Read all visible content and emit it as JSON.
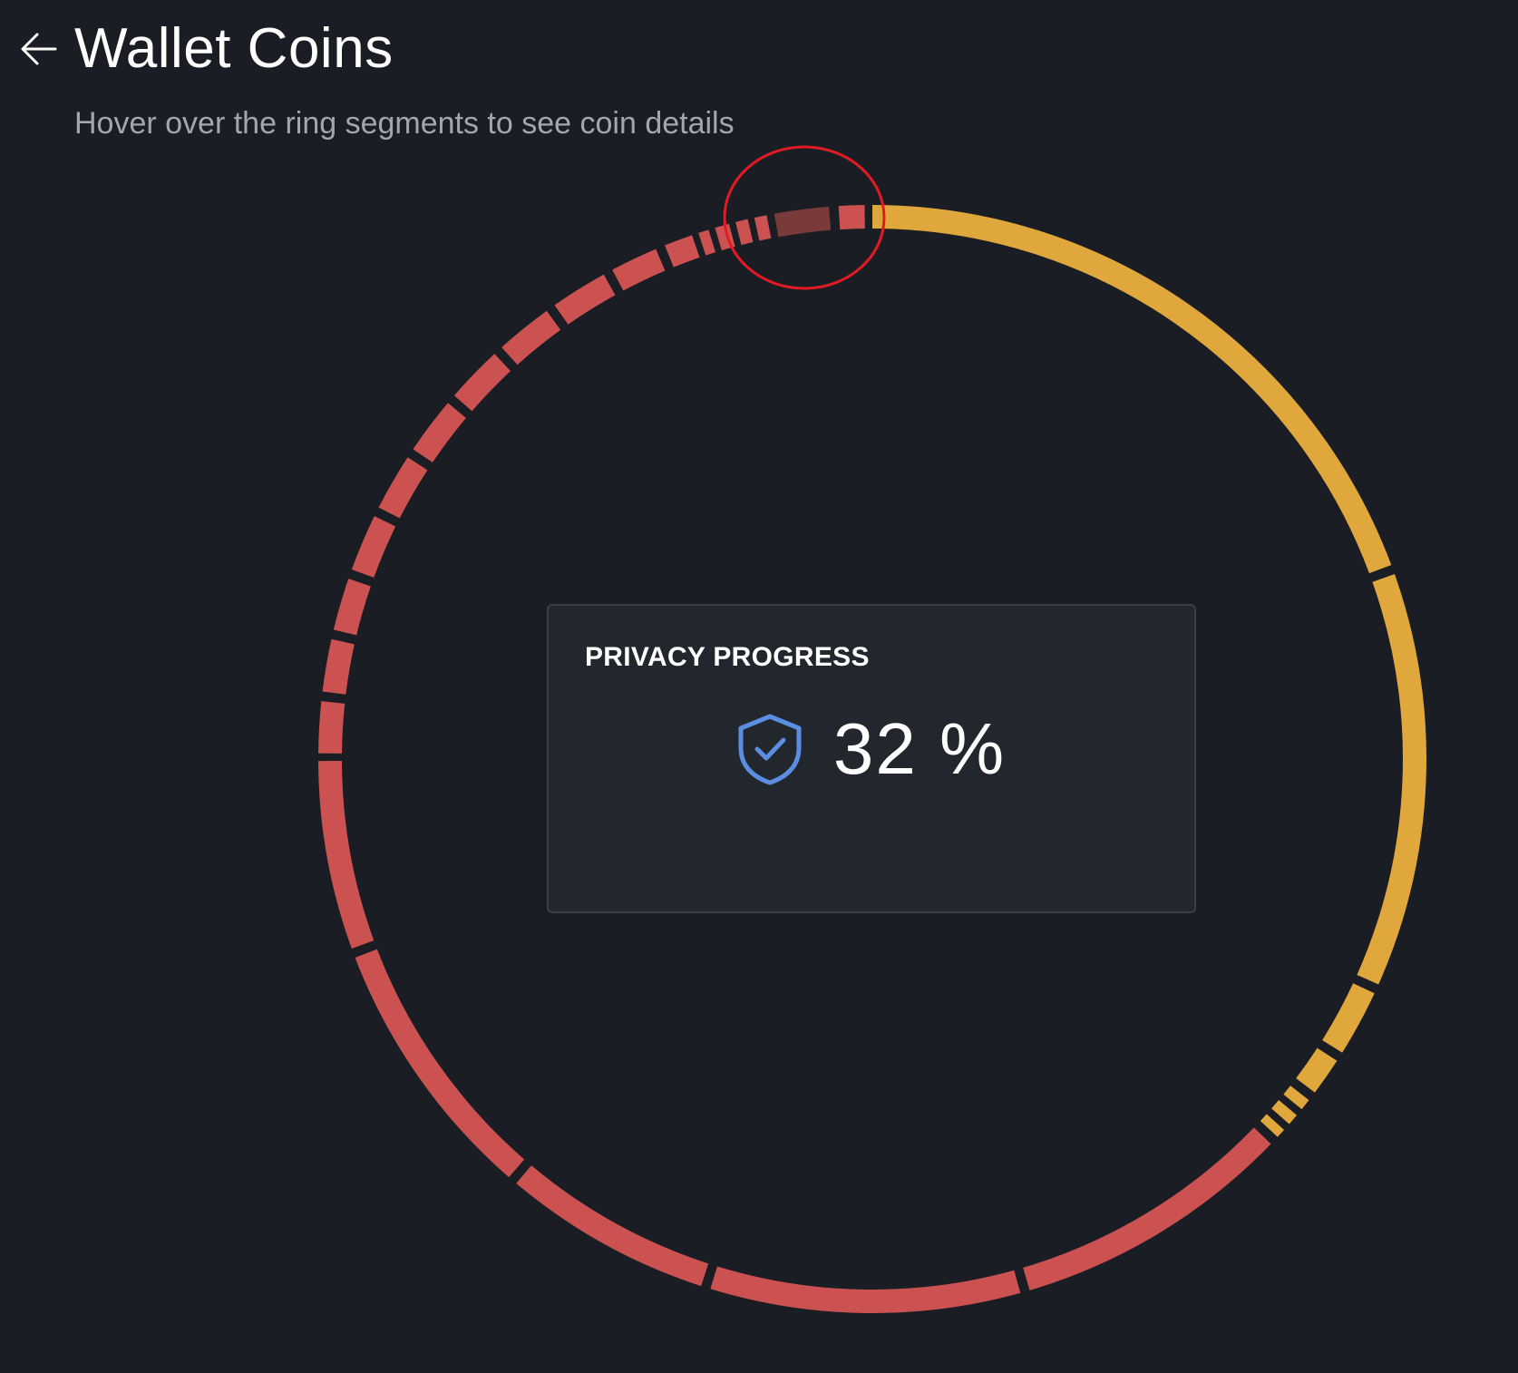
{
  "header": {
    "title": "Wallet Coins",
    "back_icon": "arrow-left-icon"
  },
  "subtitle": "Hover over the ring segments to see coin details",
  "privacy": {
    "label": "PRIVACY PROGRESS",
    "value": "32 %",
    "icon": "shield-check-icon"
  },
  "colors": {
    "background": "#1a1d23",
    "private": "#e0a73d",
    "non_private": "#cc5252",
    "highlighted": "#7a3a3a",
    "shield": "#5b8ee0",
    "annotation": "#e01b24"
  },
  "ring": {
    "segments": [
      {
        "status": "private",
        "from": 0,
        "to": 69.5
      },
      {
        "status": "private",
        "from": 70.5,
        "to": 114
      },
      {
        "status": "private",
        "from": 115,
        "to": 122
      },
      {
        "status": "private",
        "from": 123,
        "to": 127
      },
      {
        "status": "private",
        "from": 128,
        "to": 129.2
      },
      {
        "status": "private",
        "from": 130,
        "to": 131.2
      },
      {
        "status": "private",
        "from": 132,
        "to": 133
      },
      {
        "status": "non_private",
        "from": 134,
        "to": 163.5
      },
      {
        "status": "non_private",
        "from": 164.5,
        "to": 197
      },
      {
        "status": "non_private",
        "from": 198,
        "to": 220
      },
      {
        "status": "non_private",
        "from": 221,
        "to": 249
      },
      {
        "status": "non_private",
        "from": 250,
        "to": 269.8
      },
      {
        "status": "non_private",
        "from": 270.6,
        "to": 276
      },
      {
        "status": "non_private",
        "from": 277,
        "to": 282.5
      },
      {
        "status": "non_private",
        "from": 283.5,
        "to": 289
      },
      {
        "status": "non_private",
        "from": 290,
        "to": 296
      },
      {
        "status": "non_private",
        "from": 297,
        "to": 303
      },
      {
        "status": "non_private",
        "from": 304,
        "to": 310
      },
      {
        "status": "non_private",
        "from": 311,
        "to": 317
      },
      {
        "status": "non_private",
        "from": 318,
        "to": 324
      },
      {
        "status": "non_private",
        "from": 325,
        "to": 331
      },
      {
        "status": "non_private",
        "from": 332,
        "to": 337
      },
      {
        "status": "non_private",
        "from": 338,
        "to": 341
      },
      {
        "status": "non_private",
        "from": 341.7,
        "to": 342.8
      },
      {
        "status": "non_private",
        "from": 343.5,
        "to": 345
      },
      {
        "status": "non_private",
        "from": 345.7,
        "to": 347
      },
      {
        "status": "non_private",
        "from": 347.7,
        "to": 349
      },
      {
        "status": "highlighted",
        "from": 349.8,
        "to": 355.5
      },
      {
        "status": "non_private",
        "from": 356.5,
        "to": 359.2
      }
    ]
  }
}
